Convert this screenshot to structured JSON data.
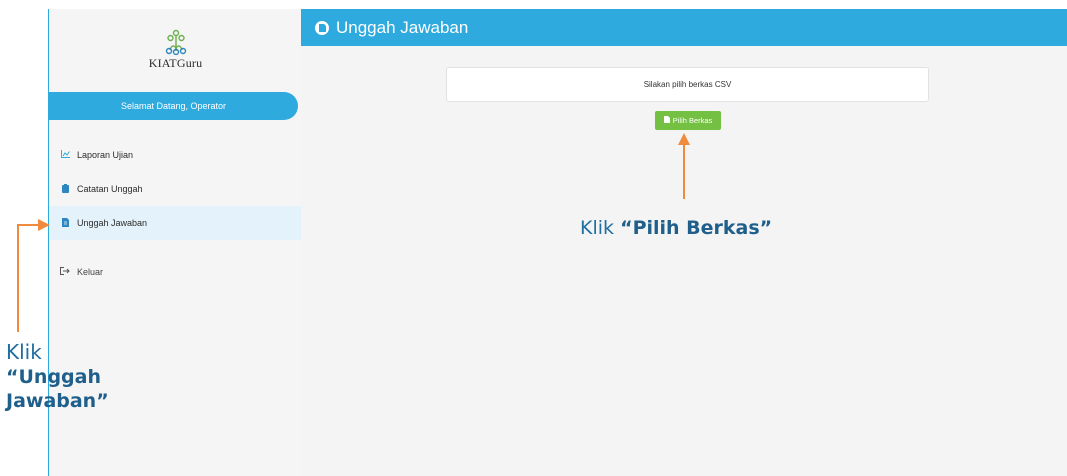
{
  "sidebar": {
    "logo_text": "KIATGuru",
    "welcome": "Selamat Datang, Operator",
    "items": [
      {
        "label": "Laporan Ujian",
        "icon": "chart-icon"
      },
      {
        "label": "Catatan Unggah",
        "icon": "clipboard-icon"
      },
      {
        "label": "Unggah Jawaban",
        "icon": "file-icon",
        "active": true
      },
      {
        "label": "Keluar",
        "icon": "logout-icon"
      }
    ]
  },
  "header": {
    "title": "Unggah Jawaban",
    "icon": "upload-circle-icon"
  },
  "main": {
    "prompt": "Silakan pilih berkas CSV",
    "button_label": "Pilih Berkas"
  },
  "annotations": {
    "pilih": {
      "prefix": "Klik",
      "emphasis": "“Pilih Berkas”"
    },
    "unggah": {
      "prefix": "Klik",
      "emphasis": "“Unggah Jawaban”"
    }
  },
  "colors": {
    "primary_blue": "#2eaadf",
    "button_green": "#74c043",
    "annotation_orange": "#f08a3c",
    "annotation_text": "#1f5f8b"
  }
}
